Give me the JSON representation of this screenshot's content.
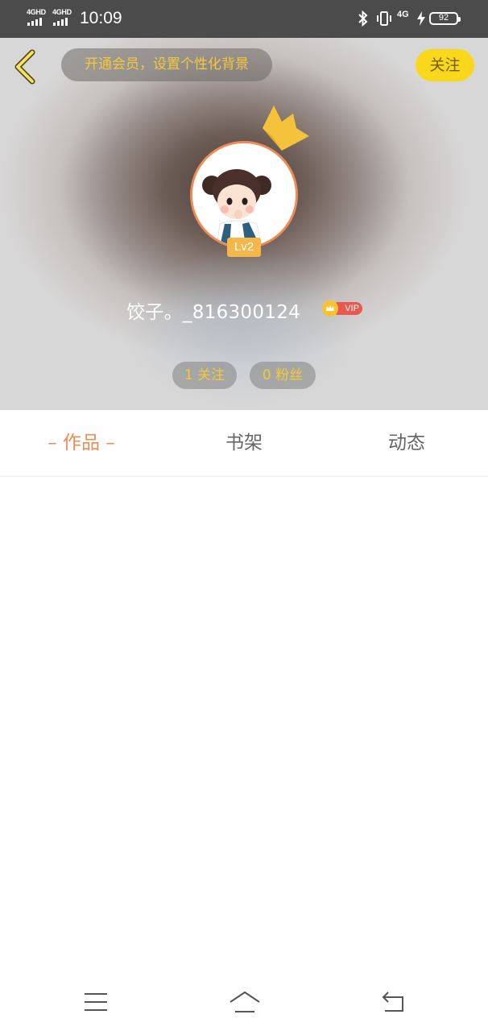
{
  "status_bar": {
    "signal1": "4GHD",
    "signal2": "4GHD",
    "time": "10:09",
    "network": "4G",
    "battery": "92"
  },
  "header": {
    "banner_text": "开通会员，设置个性化背景",
    "follow_label": "关注",
    "level": "Lv2",
    "username": "饺子。_816300124",
    "vip_label": "VIP",
    "following": "1 关注",
    "fans": "0 粉丝"
  },
  "tabs": [
    {
      "label": "– 作品 –",
      "active": true
    },
    {
      "label": "书架",
      "active": false
    },
    {
      "label": "动态",
      "active": false
    }
  ],
  "colors": {
    "accent": "#ef8b54",
    "yellow": "#f9d81c",
    "banner_text": "#f5c83b"
  },
  "nav_icons": [
    "menu-icon",
    "home-icon",
    "back-icon"
  ]
}
